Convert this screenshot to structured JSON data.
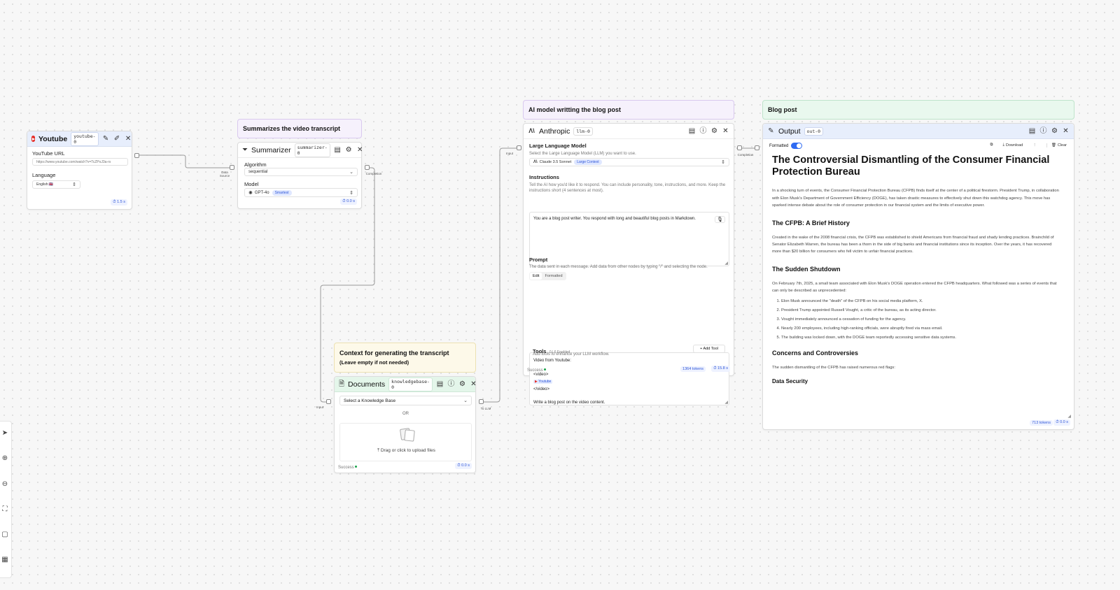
{
  "comments": {
    "summarizer": "Summarizes the video transcript",
    "anthropic": "AI model writting the blog post",
    "output": "Blog post",
    "documents_line1": "Context for generating the transcript",
    "documents_line2": "(Leave empty if not needed)"
  },
  "youtube_node": {
    "title": "Youtube",
    "id": "youtube-0",
    "url_label": "YouTube URL",
    "url_placeholder": "https://www.youtube.com/watch?v=TcZPoJ3a-rs",
    "language_label": "Language",
    "language_value": "English 🇬🇧",
    "time": "⏱ 1.5 s",
    "handle_out": "Data Source"
  },
  "summarizer_node": {
    "title": "Summarizer",
    "id": "summarizer-0",
    "algorithm_label": "Algorithm",
    "algorithm_value": "sequential",
    "model_label": "Model",
    "model_value": "GPT-4o",
    "model_badge": "Smartest",
    "time": "⏱ 0.0 s",
    "handle_out": "Completion"
  },
  "anthropic_node": {
    "title": "Anthropic",
    "id": "llm-0",
    "llm_label": "Large Language Model",
    "llm_sub": "Select the Large Language Model (LLM) you want to use.",
    "llm_value": "Claude 3.5 Sonnet",
    "llm_badge": "Large Context",
    "instructions_label": "Instructions",
    "instructions_sub": "Tell the AI how you'd like it to respond. You can include personality, tone, instructions, and more. Keep the instructions short (4 sentences at most).",
    "instructions_value": "You are a blog post writer. You respond with long and beautiful blog posts in Markdown.",
    "prompt_label": "Prompt",
    "prompt_sub": "The data sent in each message. Add data from other nodes by typing \"/\" and selecting the node.",
    "tab_edit": "Edit",
    "tab_formatted": "Formatted",
    "prompt_line1": "Video from Youtube:",
    "prompt_line2": "<video>",
    "prompt_chip": "Youtube",
    "prompt_line3": "</video>",
    "prompt_line4": "Write a blog post on the video content.",
    "tools_label": "Tools",
    "tools_count": "0 | 6 Enabled",
    "tools_sub": "Add tools to enhance your LLM workflow.",
    "add_tool": "+ Add Tool",
    "status": "Success",
    "tokens": "1364 tokens",
    "time": "⏱ 15.8 s",
    "handle_in": "Input",
    "handle_out": "Completion"
  },
  "output_node": {
    "title": "Output",
    "id": "out-0",
    "formatted_label": "Formatted",
    "download": "Download",
    "clear": "Clear",
    "tokens": "713 tokens",
    "time": "⏱ 0.0 s",
    "h1": "The Controversial Dismantling of the Consumer Financial Protection Bureau",
    "p1": "In a shocking turn of events, the Consumer Financial Protection Bureau (CFPB) finds itself at the center of a political firestorm. President Trump, in collaboration with Elon Musk's Department of Government Efficiency (DOGE), has taken drastic measures to effectively shut down this watchdog agency. This move has sparked intense debate about the role of consumer protection in our financial system and the limits of executive power.",
    "h2a": "The CFPB: A Brief History",
    "p2": "Created in the wake of the 2008 financial crisis, the CFPB was established to shield Americans from financial fraud and shady lending practices. Brainchild of Senator Elizabeth Warren, the bureau has been a thorn in the side of big banks and financial institutions since its inception. Over the years, it has recovered more than $20 billion for consumers who fell victim to unfair financial practices.",
    "h2b": "The Sudden Shutdown",
    "p3": "On February 7th, 2025, a small team associated with Elon Musk's DOGE operation entered the CFPB headquarters. What followed was a series of events that can only be described as unprecedented:",
    "list": [
      "Elon Musk announced the \"death\" of the CFPB on his social media platform, X.",
      "President Trump appointed Russell Vought, a critic of the bureau, as its acting director.",
      "Vought immediately announced a cessation of funding for the agency.",
      "Nearly 200 employees, including high-ranking officials, were abruptly fired via mass email.",
      "The building was locked down, with the DOGE team reportedly accessing sensitive data systems."
    ],
    "h2c": "Concerns and Controversies",
    "p4": "The sudden dismantling of the CFPB has raised numerous red flags:",
    "h3": "Data Security"
  },
  "documents_node": {
    "title": "Documents",
    "id": "knowledgebase-0",
    "select_value": "Select a Knowledge Base",
    "or": "OR",
    "upload": "Drag or click to upload files",
    "status": "Success",
    "time": "⏱ 0.0 s",
    "handle_in": "Input",
    "handle_out": "To LLM"
  }
}
